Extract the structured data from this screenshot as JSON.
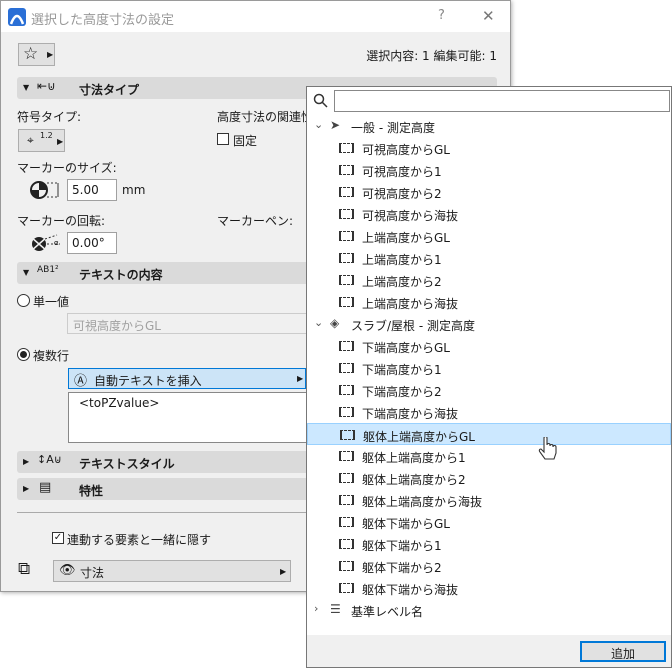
{
  "dialog": {
    "title": "選択した高度寸法の設定",
    "help": "?",
    "close": "✕",
    "selection_info": "選択内容: 1 編集可能: 1",
    "sections": {
      "dim_type": "寸法タイプ",
      "text_content": "テキストの内容",
      "text_style": "テキストスタイル",
      "properties": "特性"
    },
    "symbol_type_label": "符号タイプ:",
    "symbol_type_value": "1.2",
    "association_label": "高度寸法の関連性",
    "fixed_label": "固定",
    "fixed_checked": false,
    "marker_size_label": "マーカーのサイズ:",
    "marker_size_value": "5.00",
    "marker_size_unit": "mm",
    "marker_rotation_label": "マーカーの回転:",
    "marker_rotation_value": "0.00°",
    "marker_pen_label": "マーカーペン:",
    "single_value_label": "単一値",
    "single_value_field": "可視高度からGL",
    "multi_line_label": "複数行",
    "insert_autotext_label": "自動テキストを挿入",
    "text_area_value": "<toPZvalue>",
    "hide_with_element_label": "連動する要素と一緒に隠す",
    "hide_with_element_checked": true,
    "layer_value": "寸法"
  },
  "popup": {
    "search_placeholder": "",
    "add_button": "追加",
    "groups": [
      {
        "label": "一般 - 測定高度",
        "expanded": true,
        "items": [
          "可視高度からGL",
          "可視高度から1",
          "可視高度から2",
          "可視高度から海抜",
          "上端高度からGL",
          "上端高度から1",
          "上端高度から2",
          "上端高度から海抜"
        ]
      },
      {
        "label": "スラブ/屋根 - 測定高度",
        "expanded": true,
        "items": [
          "下端高度からGL",
          "下端高度から1",
          "下端高度から2",
          "下端高度から海抜",
          "躯体上端高度からGL",
          "躯体上端高度から1",
          "躯体上端高度から2",
          "躯体上端高度から海抜",
          "躯体下端からGL",
          "躯体下端から1",
          "躯体下端から2",
          "躯体下端から海抜"
        ]
      },
      {
        "label": "基準レベル名",
        "expanded": false,
        "items": []
      }
    ],
    "selected_item": "躯体上端高度からGL"
  },
  "colors": {
    "accent": "#0078d7",
    "highlight": "#cce8ff"
  }
}
